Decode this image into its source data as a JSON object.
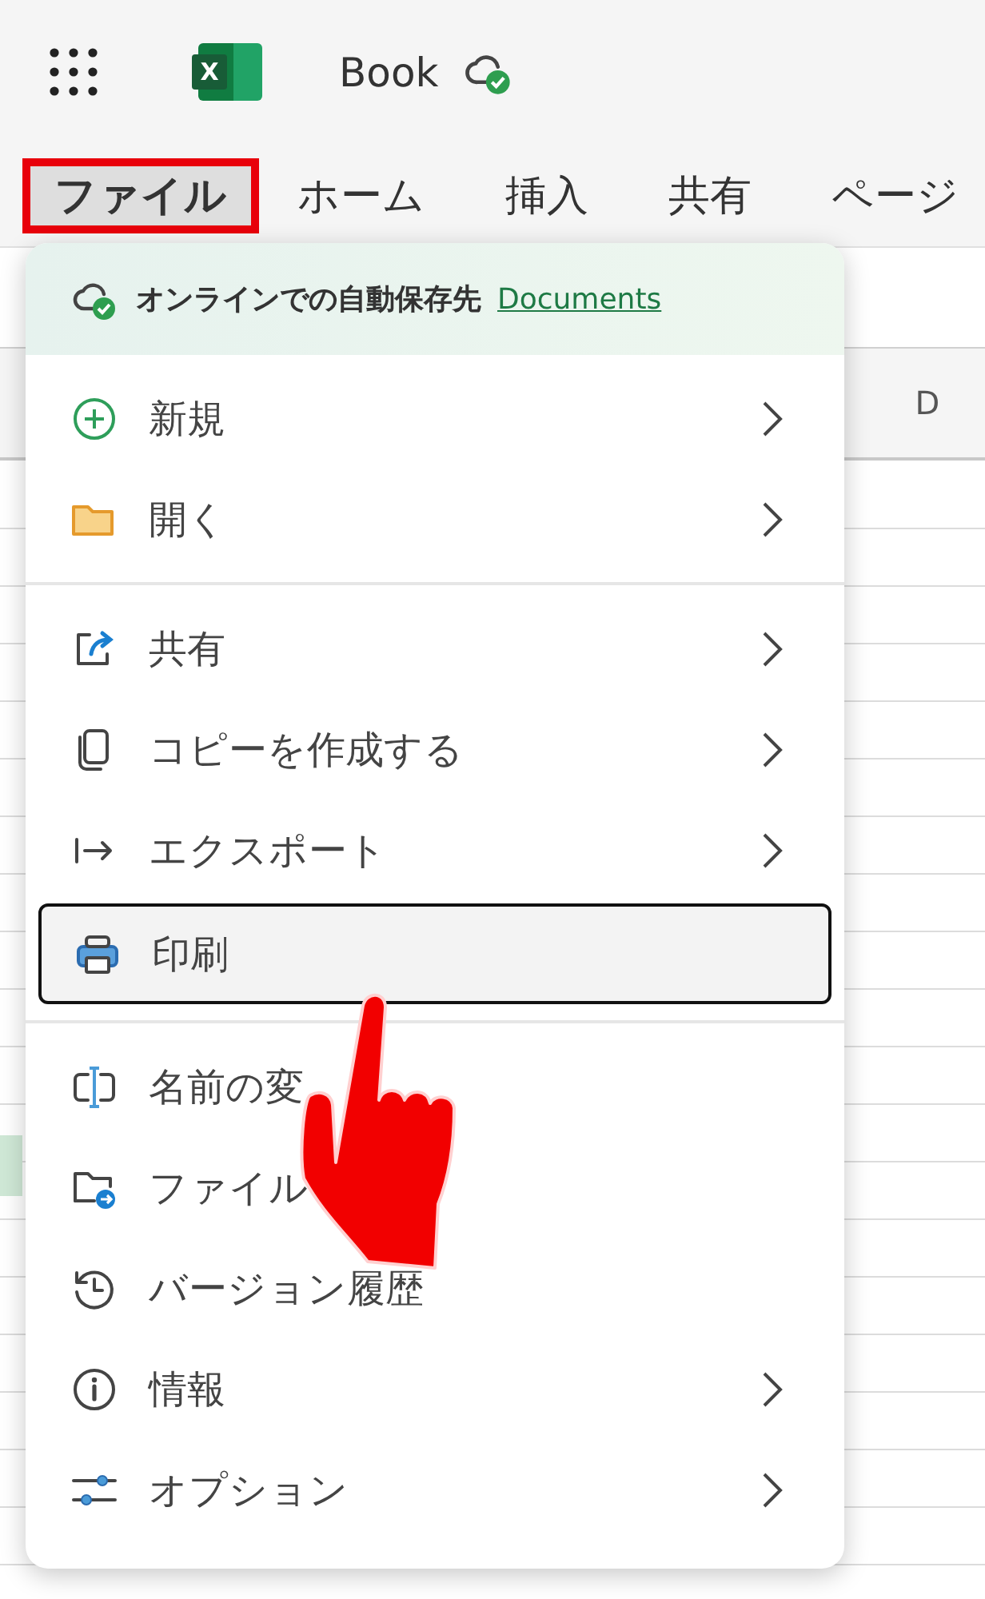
{
  "app": {
    "logo_letter": "X",
    "document_title": "Book"
  },
  "ribbon_tabs": [
    {
      "label": "ファイル",
      "selected": true,
      "highlighted": true
    },
    {
      "label": "ホーム",
      "selected": false,
      "highlighted": false
    },
    {
      "label": "挿入",
      "selected": false,
      "highlighted": false
    },
    {
      "label": "共有",
      "selected": false,
      "highlighted": false
    },
    {
      "label": "ページ",
      "selected": false,
      "highlighted": false
    }
  ],
  "sheet": {
    "column_header": "D"
  },
  "file_menu": {
    "autosave_text": "オンラインでの自動保存先",
    "autosave_link": "Documents",
    "groups": [
      [
        {
          "label": "新規",
          "submenu": true,
          "focused": false
        },
        {
          "label": "開く",
          "submenu": true,
          "focused": false
        }
      ],
      [
        {
          "label": "共有",
          "submenu": true,
          "focused": false
        },
        {
          "label": "コピーを作成する",
          "submenu": true,
          "focused": false
        },
        {
          "label": "エクスポート",
          "submenu": true,
          "focused": false
        },
        {
          "label": "印刷",
          "submenu": false,
          "focused": true
        }
      ],
      [
        {
          "label": "名前の変",
          "submenu": false,
          "focused": false
        },
        {
          "label": "ファイル",
          "submenu": false,
          "focused": false
        },
        {
          "label": "バージョン履歴",
          "submenu": false,
          "focused": false
        },
        {
          "label": "情報",
          "submenu": true,
          "focused": false
        },
        {
          "label": "オプション",
          "submenu": true,
          "focused": false
        }
      ]
    ]
  }
}
